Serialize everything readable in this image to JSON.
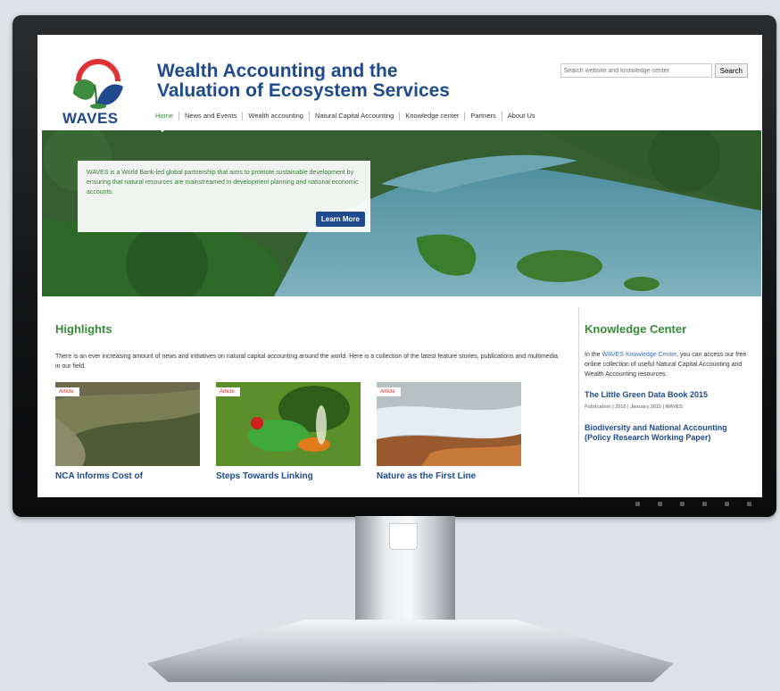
{
  "site": {
    "logo_word": "WAVES",
    "title_line1": "Wealth Accounting and the",
    "title_line2": "Valuation of Ecosystem Services"
  },
  "search": {
    "placeholder": "Search website and knowledge center",
    "button_label": "Search"
  },
  "nav": {
    "items": [
      {
        "label": "Home"
      },
      {
        "label": "News and Events"
      },
      {
        "label": "Wealth accounting"
      },
      {
        "label": "Natural Capital Accounting"
      },
      {
        "label": "Knowledge center"
      },
      {
        "label": "Partners"
      },
      {
        "label": "About Us"
      }
    ]
  },
  "hero": {
    "text": "WAVES is a World Bank-led global partnership that aims to promote sustainable development by ensuring that natural resources are mainstreamed in development planning and national economic accounts.",
    "button_label": "Learn More"
  },
  "highlights": {
    "heading": "Highlights",
    "intro": "There is an ever increasing amount of news and initiatives on natural capital accounting around the world. Here is a collection of the latest feature stories, publications and multimedia in our field.",
    "cards": [
      {
        "tag": "Article",
        "title": "NCA Informs Cost of"
      },
      {
        "tag": "Article",
        "title": "Steps Towards Linking"
      },
      {
        "tag": "Article",
        "title": "Nature as the First Line"
      }
    ]
  },
  "knowledge_center": {
    "heading": "Knowledge Center",
    "text_before": "In the ",
    "link": "WAVES Knowledge Center",
    "text_after": ", you can access our free online collection of useful Natural Capital Accounting and Wealth Accounting resources.",
    "items": [
      {
        "title": "The Little Green Data Book 2015",
        "meta": "Publication | 2015 | January 2015 | WAVES"
      },
      {
        "title": "Biodiversity and National Accounting (Policy Research Working Paper)",
        "meta": ""
      }
    ]
  },
  "colors": {
    "brand_blue": "#1f4b8e",
    "brand_green": "#3a8a3a",
    "link_blue": "#3a6fbf"
  }
}
